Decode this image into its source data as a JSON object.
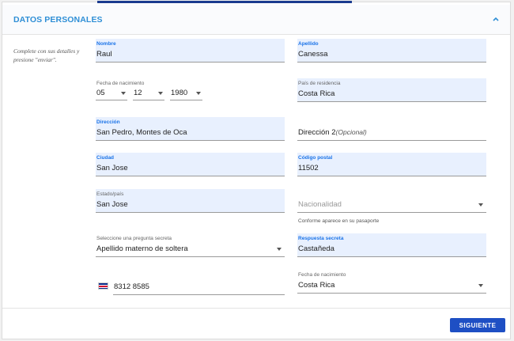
{
  "section": {
    "title": "DATOS PERSONALES"
  },
  "instructions": "Complete con sus detalles y presione \"enviar\".",
  "form": {
    "first_name": {
      "label": "Nombre",
      "value": "Raul"
    },
    "last_name": {
      "label": "Apellido",
      "value": "Canessa"
    },
    "birth_date": {
      "label": "Fecha de nacimiento",
      "month": "05",
      "day": "12",
      "year": "1980"
    },
    "residence_country": {
      "label": "País de residencia",
      "value": "Costa Rica"
    },
    "address": {
      "label": "Dirección",
      "value": "San Pedro, Montes de Oca"
    },
    "address2": {
      "label": "Dirección 2",
      "optional": "(Opcional)"
    },
    "city": {
      "label": "Ciudad",
      "value": "San Jose"
    },
    "postal_code": {
      "label": "Código postal",
      "value": "11502"
    },
    "state": {
      "label": "Estado/país",
      "value": "San Jose"
    },
    "nationality": {
      "placeholder": "Nacionalidad",
      "hint": "Conforme aparece en su pasaporte"
    },
    "secret_question": {
      "label": "Seleccione una pregunta secreta",
      "value": "Apellido materno de soltera"
    },
    "secret_answer": {
      "label": "Respuesta secreta",
      "value": "Castañeda"
    },
    "phone": {
      "value": "8312 8585",
      "flag_icon": "costa-rica-flag-icon"
    },
    "birth_country": {
      "label": "Fecha de nacimiento",
      "value": "Costa Rica"
    }
  },
  "actions": {
    "next_label": "SIGUIENTE"
  },
  "colors": {
    "accent": "#2f8fd6",
    "button": "#1e4fc4",
    "filled_bg": "#e8f0fe",
    "top_accent": "#1a3b8f"
  }
}
